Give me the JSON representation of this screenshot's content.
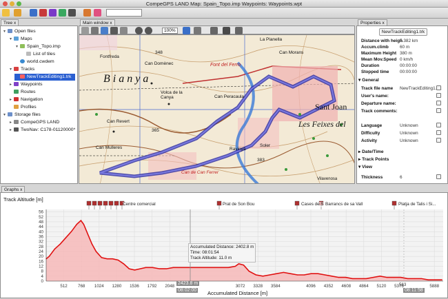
{
  "window": {
    "title": "CompeGPS LAND Map: Spain_Topo.imp Waypoints: Waypoints.wpt"
  },
  "toolbar": {
    "zoom": "100%"
  },
  "tree": {
    "tab": "Tree",
    "close": "x",
    "items": [
      {
        "label": "Open files",
        "twisty": "▾"
      },
      {
        "label": "Maps",
        "twisty": "▾"
      },
      {
        "label": "Spain_Topo.imp",
        "twisty": "▾"
      },
      {
        "label": "List of tiles",
        "twisty": ""
      },
      {
        "label": "world.cwdem",
        "twisty": ""
      },
      {
        "label": "Tracks",
        "twisty": "▾"
      },
      {
        "label": "NewTrackEditing1.trk",
        "twisty": ""
      },
      {
        "label": "Waypoints",
        "twisty": "▸"
      },
      {
        "label": "Routes",
        "twisty": ""
      },
      {
        "label": "Navigation",
        "twisty": "▸"
      },
      {
        "label": "Profiles",
        "twisty": ""
      },
      {
        "label": "Storage files",
        "twisty": "▾"
      },
      {
        "label": "CompeGPS LAND",
        "twisty": "▸"
      },
      {
        "label": "TwoNav: C178-01120000*",
        "twisty": "▸"
      }
    ]
  },
  "map": {
    "tab": "Main window",
    "close": "x",
    "labels": [
      "La Planella",
      "Can Morans",
      "Fontfreda",
      "348",
      "Can Domènec",
      "Font del Ferro",
      "Bianya",
      "Volca de la Canya",
      "Can Peracaula",
      "Sant Joan",
      "Can Revert",
      "Les Feixes del",
      "Can Mulleres",
      "365",
      "Soler",
      "Ravinyà",
      "383",
      "Can de Can Ferrer",
      "Vilavenosa"
    ]
  },
  "properties": {
    "tab": "Properties",
    "close": "x",
    "name_field": "NewTrackEditing1.trk",
    "stats": [
      {
        "k": "Distance with heigh",
        "v": "5.382 km"
      },
      {
        "k": "Accum.climb",
        "v": "60 m"
      },
      {
        "k": "Maximum Height",
        "v": "380 m"
      },
      {
        "k": "Mean Mov.Speed",
        "v": "0 km/h"
      },
      {
        "k": "Duration",
        "v": "00:00:00"
      },
      {
        "k": "Stopped time",
        "v": "00:00:00"
      }
    ],
    "general_title": "General",
    "general": [
      {
        "k": "Track file name",
        "v": "NewTrackEditing1.trk"
      },
      {
        "k": "User's name:",
        "v": ""
      },
      {
        "k": "Departure name:",
        "v": ""
      },
      {
        "k": "Track comments:",
        "v": ""
      }
    ],
    "meta": [
      {
        "k": "Language",
        "v": "Unknown"
      },
      {
        "k": "Difficulty",
        "v": "Unknown"
      },
      {
        "k": "Activity",
        "v": "Unknown"
      }
    ],
    "sections": [
      "Date/Time",
      "Track Points",
      "View"
    ],
    "thickness": {
      "k": "Thickness",
      "v": "6"
    }
  },
  "graph": {
    "tab": "Graphs",
    "close": "x",
    "ylabel": "Track Altitude [m]",
    "xlabel": "Accumulated Distance [m]",
    "cursor_distance": "2423.8 m",
    "cursor_time": "08:02:00",
    "end_time": "08:11:58",
    "end_distance": "563",
    "tooltip": [
      "Accumulated Distance: 2402.8 m",
      "Time: 08:01:54",
      "Track Altitude: 11.0 m"
    ],
    "waypoints": [
      "Centre comercial",
      "Prat de Son Bou",
      "Cases de S",
      "Barrancs de sa Vall",
      "Platja de Talis i Si..."
    ]
  },
  "chart_data": {
    "type": "area",
    "ylabel": "Track Altitude [m]",
    "xlabel": "Accumulated Distance [m]",
    "ylim": [
      0,
      58
    ],
    "xlim": [
      256,
      6016
    ],
    "yticks": [
      0,
      4,
      8,
      12,
      16,
      20,
      24,
      28,
      32,
      36,
      40,
      44,
      48,
      52,
      56
    ],
    "xticks": [
      512,
      768,
      1024,
      1280,
      1536,
      1792,
      2048,
      3072,
      3328,
      3584,
      4096,
      4352,
      4608,
      4864,
      5120,
      5376,
      5888
    ],
    "x": [
      256,
      300,
      380,
      460,
      540,
      620,
      700,
      760,
      800,
      860,
      920,
      980,
      1060,
      1140,
      1220,
      1300,
      1380,
      1460,
      1540,
      1620,
      1700,
      1800,
      1900,
      2000,
      2100,
      2200,
      2300,
      2400,
      2500,
      2600,
      2700,
      2800,
      2900,
      3000,
      3050,
      3120,
      3200,
      3300,
      3400,
      3500,
      3600,
      3700,
      3800,
      3900,
      4000,
      4100,
      4200,
      4300,
      4400,
      4500,
      4600,
      4700,
      4800,
      4900,
      5000,
      5100,
      5200,
      5300,
      5400,
      5500,
      5600,
      5700,
      5800,
      5900,
      6000
    ],
    "y": [
      18,
      20,
      26,
      30,
      35,
      40,
      46,
      49,
      46,
      38,
      30,
      24,
      19,
      18,
      18,
      17,
      14,
      10,
      9,
      10,
      11,
      11,
      10,
      10,
      11,
      11,
      11,
      11,
      11,
      11,
      11,
      11,
      11,
      12,
      14,
      13,
      8,
      5,
      4,
      5,
      6,
      7,
      6,
      5,
      5,
      6,
      6,
      5,
      4,
      3,
      3,
      2,
      2,
      2,
      3,
      4,
      3,
      3,
      3,
      2,
      2,
      2,
      1,
      1,
      1
    ]
  }
}
